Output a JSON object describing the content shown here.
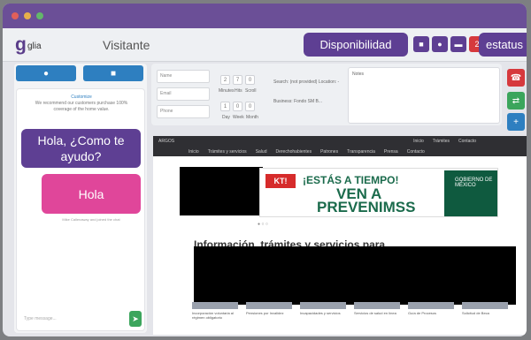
{
  "app": {
    "logo_text": "glia",
    "title": "Visitante",
    "availability_button": "Disponibilidad",
    "status_button": "estatus"
  },
  "left_panel": {
    "recommend_title": "Customize",
    "recommend_text": "We recommend our customers purchase 100% coverage of the home value.",
    "agent_bubble": "Hola, ¿Como te ayudo?",
    "visitor_bubble": "Hola",
    "visitor_meta": "Mike Callenaway and joined the chat",
    "message_placeholder": "Type message..."
  },
  "form": {
    "name_placeholder": "Name",
    "email_placeholder": "Email",
    "phone_placeholder": "Phone",
    "counters_row1": [
      "2",
      "7",
      "0"
    ],
    "labels_row1": [
      "Minutes",
      "Hits",
      "Scroll"
    ],
    "counters_row2": [
      "1",
      "0",
      "0"
    ],
    "labels_row2": [
      "Day",
      "Week",
      "Month"
    ],
    "search_text": "Search: (not provided) Location: -",
    "business_text": "Business: Fondo SM B...",
    "notes_label": "Notes"
  },
  "webview": {
    "nav_top": [
      "ARGOS",
      "Inicio",
      "Trámites",
      "Contacto"
    ],
    "nav_bottom": [
      "Inicio",
      "Trámites y servicios",
      "Salud",
      "Derechohabientes",
      "Patrones",
      "Transparencia",
      "Prensa",
      "Contacto"
    ],
    "banner_tag": "KT!",
    "banner_headline": "¡ESTÁS A TIEMPO!",
    "banner_line1": "VEN A",
    "banner_line2": "PREVENIMSS",
    "banner_logo": "GOBIERNO DE MÉXICO",
    "section_title": "Información, trámites y servicios para",
    "thumbs": [
      "Incorporación voluntaria al régimen obligatorio",
      "Pensiones por Invalidez",
      "Incapacidades y servicios",
      "Servicios de salud en línea",
      "Guía de Procesos",
      "Solicitud de Beca"
    ]
  },
  "colors": {
    "brand_purple": "#5e3f93",
    "pink": "#e0469a",
    "blue": "#2e7fc0",
    "red": "#d6393d",
    "green": "#3ba55c",
    "banner_green": "#1b6b4c"
  },
  "icons": {
    "mic": "mic-icon",
    "camera": "video-icon",
    "chat": "chat-icon",
    "end_call": "end-call-icon",
    "transfer": "transfer-icon",
    "add": "plus-icon",
    "send": "send-icon"
  }
}
